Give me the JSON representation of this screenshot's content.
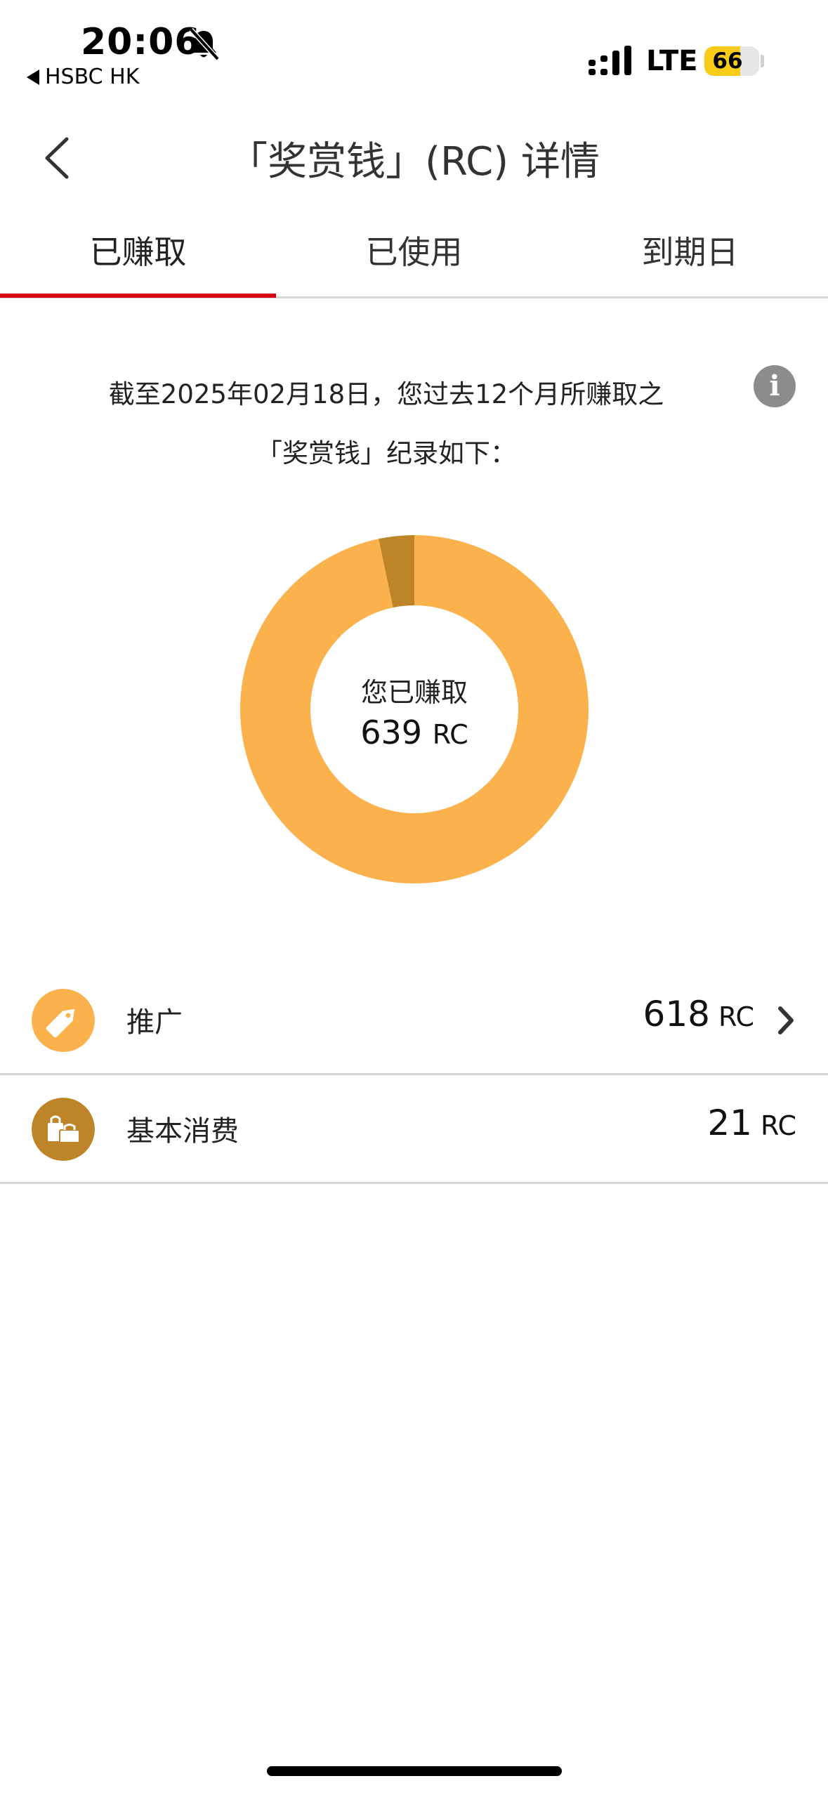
{
  "status_bar": {
    "time": "20:06",
    "back_app": "HSBC HK",
    "network": "LTE",
    "battery": 66
  },
  "header": {
    "title": "「奖赏钱」(RC) 详情"
  },
  "tabs": [
    {
      "label": "已赚取",
      "active": true
    },
    {
      "label": "已使用",
      "active": false
    },
    {
      "label": "到期日",
      "active": false
    }
  ],
  "summary": {
    "line1": "截至2025年02月18日，您过去12个月所赚取之",
    "line2": "「奖赏钱」纪录如下："
  },
  "chart_data": {
    "type": "pie",
    "series": [
      {
        "name": "推广",
        "value": 618,
        "color": "#fbb24d"
      },
      {
        "name": "基本消费",
        "value": 21,
        "color": "#be8428"
      }
    ],
    "center_label": "您已赚取",
    "total": "639",
    "unit": "RC"
  },
  "breakdown": [
    {
      "label": "推广",
      "value": "618",
      "unit": "RC",
      "icon": "tag-icon",
      "color": "#fbb24d"
    },
    {
      "label": "基本消费",
      "value": "21",
      "unit": "RC",
      "icon": "shopping-bags-icon",
      "color": "#be8428"
    }
  ]
}
